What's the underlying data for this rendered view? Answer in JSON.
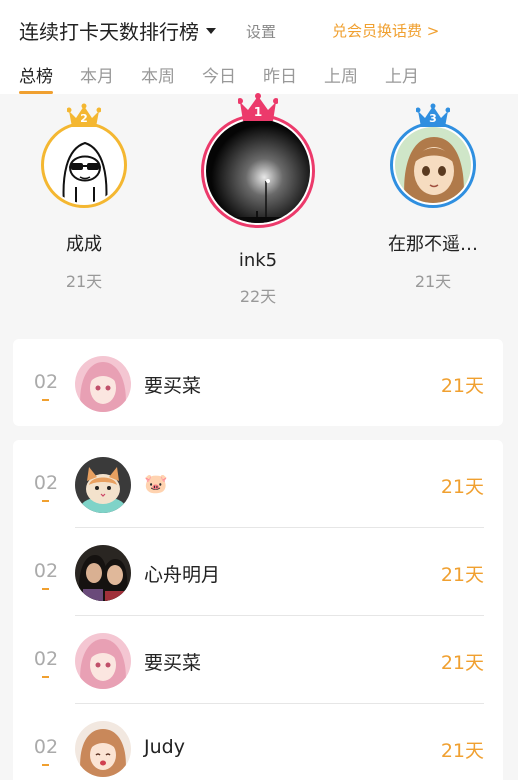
{
  "header": {
    "title": "连续打卡天数排行榜",
    "settings_label": "设置",
    "exchange_label": "兑会员换话费 >"
  },
  "tabs": [
    {
      "label": "总榜",
      "active": true
    },
    {
      "label": "本月",
      "active": false
    },
    {
      "label": "本周",
      "active": false
    },
    {
      "label": "今日",
      "active": false
    },
    {
      "label": "昨日",
      "active": false
    },
    {
      "label": "上周",
      "active": false
    },
    {
      "label": "上月",
      "active": false
    }
  ],
  "podium": [
    {
      "rank": "2",
      "name": "成成",
      "days": "21天",
      "crown_color": "#f4b731",
      "avatar": "line-drawing-sunglasses-avatar"
    },
    {
      "rank": "1",
      "name": "ink5",
      "days": "22天",
      "crown_color": "#ec3a6b",
      "avatar": "dark-streetlight-avatar"
    },
    {
      "rank": "3",
      "name": "在那不遥…",
      "days": "21天",
      "crown_color": "#2f8fe0",
      "avatar": "anime-girl-avatar"
    }
  ],
  "my_rank": {
    "rank": "02",
    "name": "要买菜",
    "days": "21天",
    "avatar": "pink-anime-avatar"
  },
  "list": [
    {
      "rank": "02",
      "name": "🐷",
      "days": "21天",
      "avatar": "cat-avatar"
    },
    {
      "rank": "02",
      "name": "心舟明月",
      "days": "21天",
      "avatar": "two-women-avatar"
    },
    {
      "rank": "02",
      "name": "要买菜",
      "days": "21天",
      "avatar": "pink-anime-avatar"
    },
    {
      "rank": "02",
      "name": "Judy",
      "days": "21天",
      "avatar": "anime-fox-girl-avatar"
    }
  ],
  "colors": {
    "accent": "#f0a030",
    "first": "#ec3a6b",
    "second": "#f4b731",
    "third": "#2f8fe0"
  }
}
